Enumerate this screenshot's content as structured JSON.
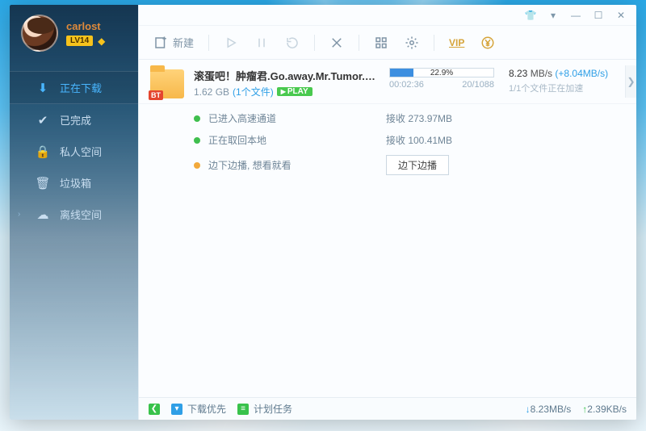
{
  "profile": {
    "username": "carlost",
    "level_badge": "LV14"
  },
  "sidebar": {
    "items": [
      {
        "label": "正在下载",
        "icon": "download"
      },
      {
        "label": "已完成",
        "icon": "check"
      },
      {
        "label": "私人空间",
        "icon": "lock"
      },
      {
        "label": "垃圾箱",
        "icon": "trash"
      },
      {
        "label": "离线空间",
        "icon": "cloud"
      }
    ]
  },
  "toolbar": {
    "new_label": "新建",
    "vip_label": "VIP"
  },
  "task": {
    "title": "滚蛋吧！肿瘤君.Go.away.Mr.Tumor.2015...",
    "size": "1.62 GB",
    "file_count_label": "(1个文件)",
    "play_badge": "PLAY",
    "bt_badge": "BT",
    "progress_pct_label": "22.9%",
    "progress_pct_value": 22.9,
    "elapsed": "00:02:36",
    "peers": "20/1088",
    "speed_value": "8.23",
    "speed_unit": "MB/s",
    "speed_boost": "(+8.04MB/s)",
    "accel_status": "1/1个文件正在加速"
  },
  "details": {
    "rows": [
      {
        "dot": "green",
        "label": "已进入高速通道",
        "value": "接收 273.97MB"
      },
      {
        "dot": "green",
        "label": "正在取回本地",
        "value": "接收 100.41MB"
      },
      {
        "dot": "orange",
        "label": "边下边播, 想看就看",
        "button": "边下边播"
      }
    ]
  },
  "status": {
    "priority_label": "下载优先",
    "schedule_label": "计划任务",
    "down_speed": "8.23MB/s",
    "up_speed": "2.39KB/s"
  }
}
